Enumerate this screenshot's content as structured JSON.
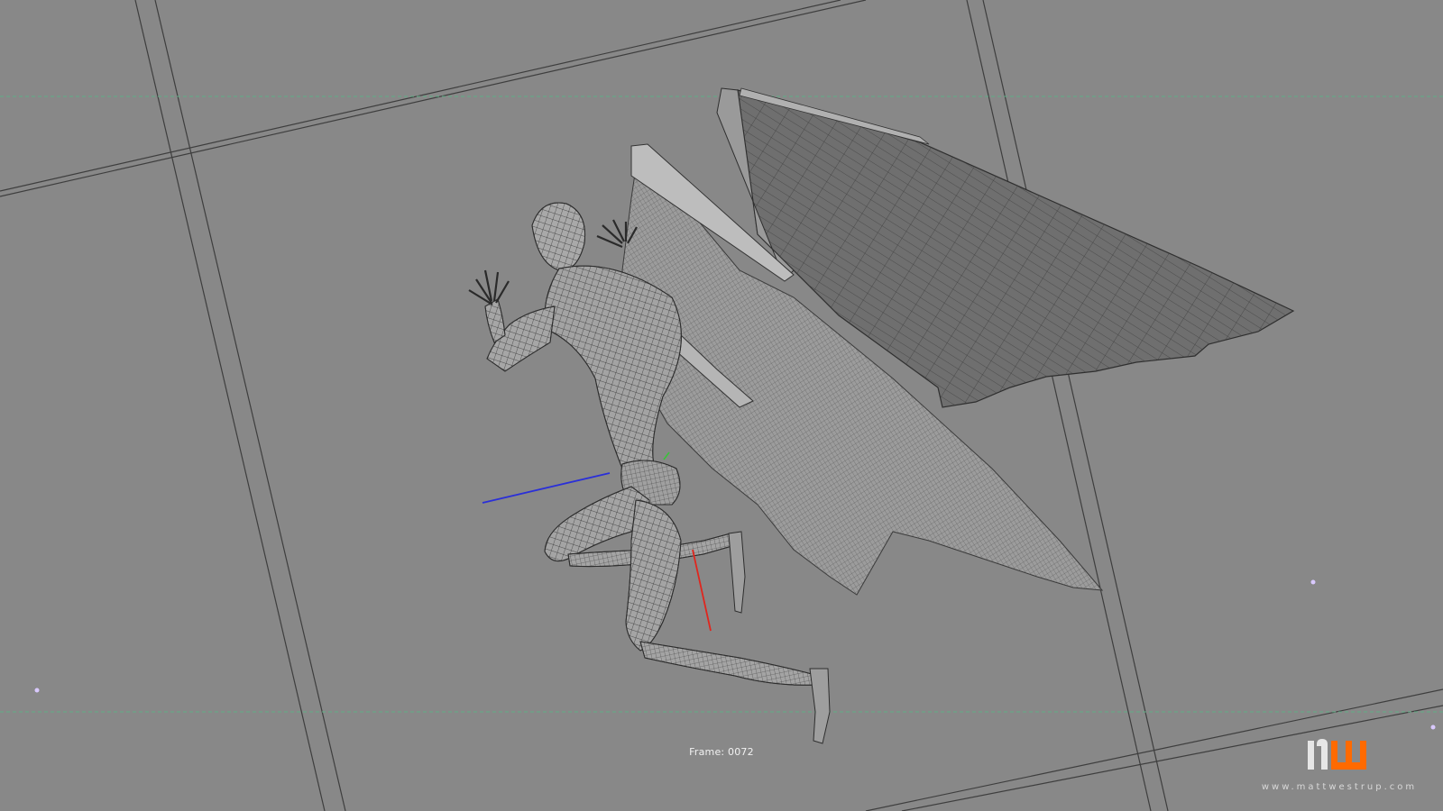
{
  "viewport": {
    "frame_counter": "Frame: 0072",
    "background": "#888888"
  },
  "scene": {
    "subject": "winged-figure-wireframe",
    "gizmo_colors": {
      "x_axis": "#e0261e",
      "z_axis": "#2a2fd8",
      "y_axis": "#3ac23a"
    },
    "safe_frame_color": "#5fae86",
    "grid_color": "#3e3e3e",
    "marker_color": "#d9c9ff"
  },
  "watermark": {
    "logo_alt": "MW",
    "accent_color": "#ff6a00",
    "url": "www.mattwestrup.com"
  }
}
